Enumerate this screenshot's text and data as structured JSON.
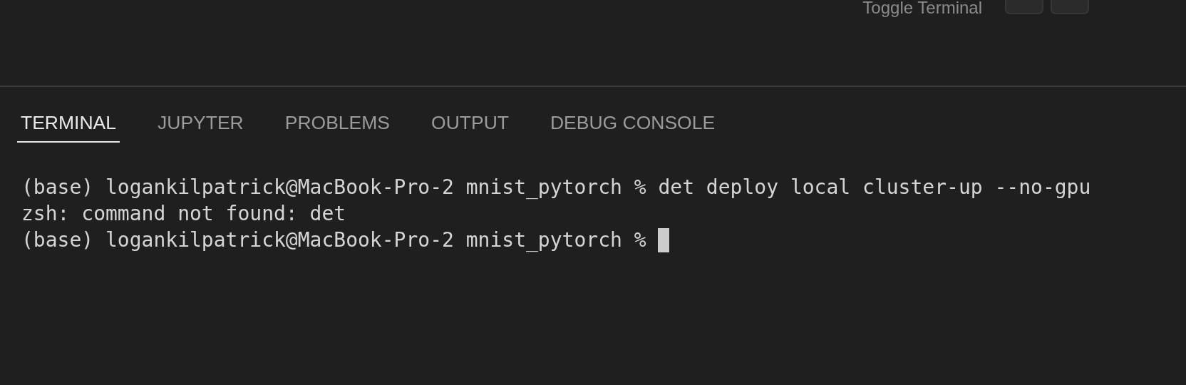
{
  "top_bar": {
    "hint": "Toggle Terminal"
  },
  "tabs": [
    {
      "label": "TERMINAL",
      "selected": true
    },
    {
      "label": "JUPYTER",
      "selected": false
    },
    {
      "label": "PROBLEMS",
      "selected": false
    },
    {
      "label": "OUTPUT",
      "selected": false
    },
    {
      "label": "DEBUG CONSOLE",
      "selected": false
    }
  ],
  "terminal": {
    "lines": [
      "(base) logankilpatrick@MacBook-Pro-2 mnist_pytorch % det deploy local cluster-up --no-gpu",
      "zsh: command not found: det",
      "(base) logankilpatrick@MacBook-Pro-2 mnist_pytorch % "
    ],
    "cursor": true
  }
}
